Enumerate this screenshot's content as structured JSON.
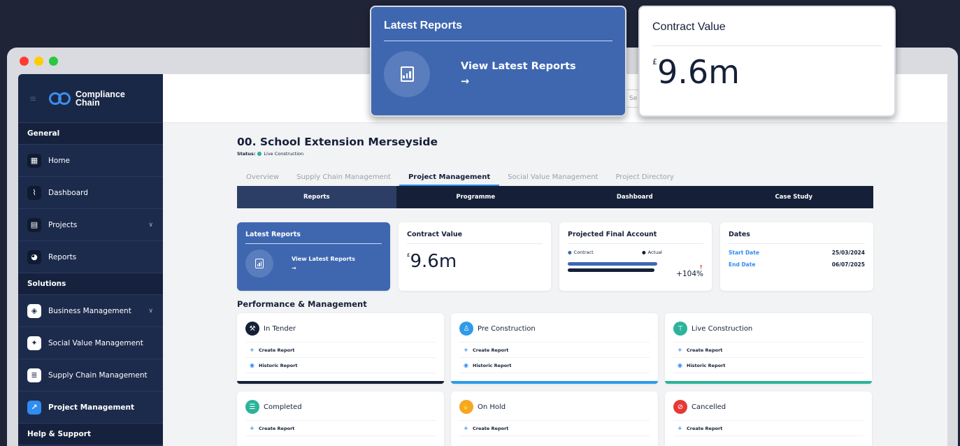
{
  "sidebar": {
    "logo_line1": "Compliance",
    "logo_line2": "Chain",
    "section_general": "General",
    "items_general": [
      {
        "label": "Home",
        "icon": "grid-icon"
      },
      {
        "label": "Dashboard",
        "icon": "chart-line-icon"
      },
      {
        "label": "Projects",
        "icon": "building-icon"
      },
      {
        "label": "Reports",
        "icon": "pie-chart-icon"
      }
    ],
    "section_solutions": "Solutions",
    "items_solutions": [
      {
        "label": "Business Management",
        "icon": "shield-icon"
      },
      {
        "label": "Social Value Management",
        "icon": "handshake-icon"
      },
      {
        "label": "Supply Chain Management",
        "icon": "chain-icon"
      },
      {
        "label": "Project Management",
        "icon": "arrow-icon"
      }
    ],
    "section_help": "Help & Support"
  },
  "search": {
    "placeholder": "Se"
  },
  "project": {
    "title": "00. School Extension Merseyside",
    "status_label": "Status:",
    "status_value": "Live Construction"
  },
  "tabs": [
    "Overview",
    "Supply Chain Management",
    "Project Management",
    "Social Value Management",
    "Project Directory"
  ],
  "subtabs": [
    "Reports",
    "Programme",
    "Dashboard",
    "Case Study"
  ],
  "cards": {
    "latest_reports": {
      "title": "Latest Reports",
      "link": "View Latest Reports",
      "arrow": "→"
    },
    "contract_value": {
      "title": "Contract Value",
      "currency": "£",
      "value": "9.6m"
    },
    "projected": {
      "title": "Projected Final Account",
      "legend_contract": "Contract",
      "legend_actual": "Actual",
      "arrow": "↑",
      "percent": "+104%"
    },
    "dates": {
      "title": "Dates",
      "start_label": "Start Date",
      "start_value": "25/03/2024",
      "end_label": "End Date",
      "end_value": "06/07/2025"
    }
  },
  "performance": {
    "title": "Performance & Management",
    "create": "Create Report",
    "historic": "Historic Report",
    "cards": [
      {
        "label": "In Tender",
        "color": "#152038"
      },
      {
        "label": "Pre Construction",
        "color": "#2f9be8"
      },
      {
        "label": "Live Construction",
        "color": "#2cb39a"
      },
      {
        "label": "Completed",
        "color": "#2cb39a"
      },
      {
        "label": "On Hold",
        "color": "#f5a623"
      },
      {
        "label": "Cancelled",
        "color": "#e53935"
      }
    ]
  },
  "overlays": {
    "latest_reports": {
      "title": "Latest Reports",
      "link": "View Latest Reports",
      "arrow": "→"
    },
    "contract_value": {
      "title": "Contract Value",
      "currency": "£",
      "value": "9.6m"
    }
  }
}
